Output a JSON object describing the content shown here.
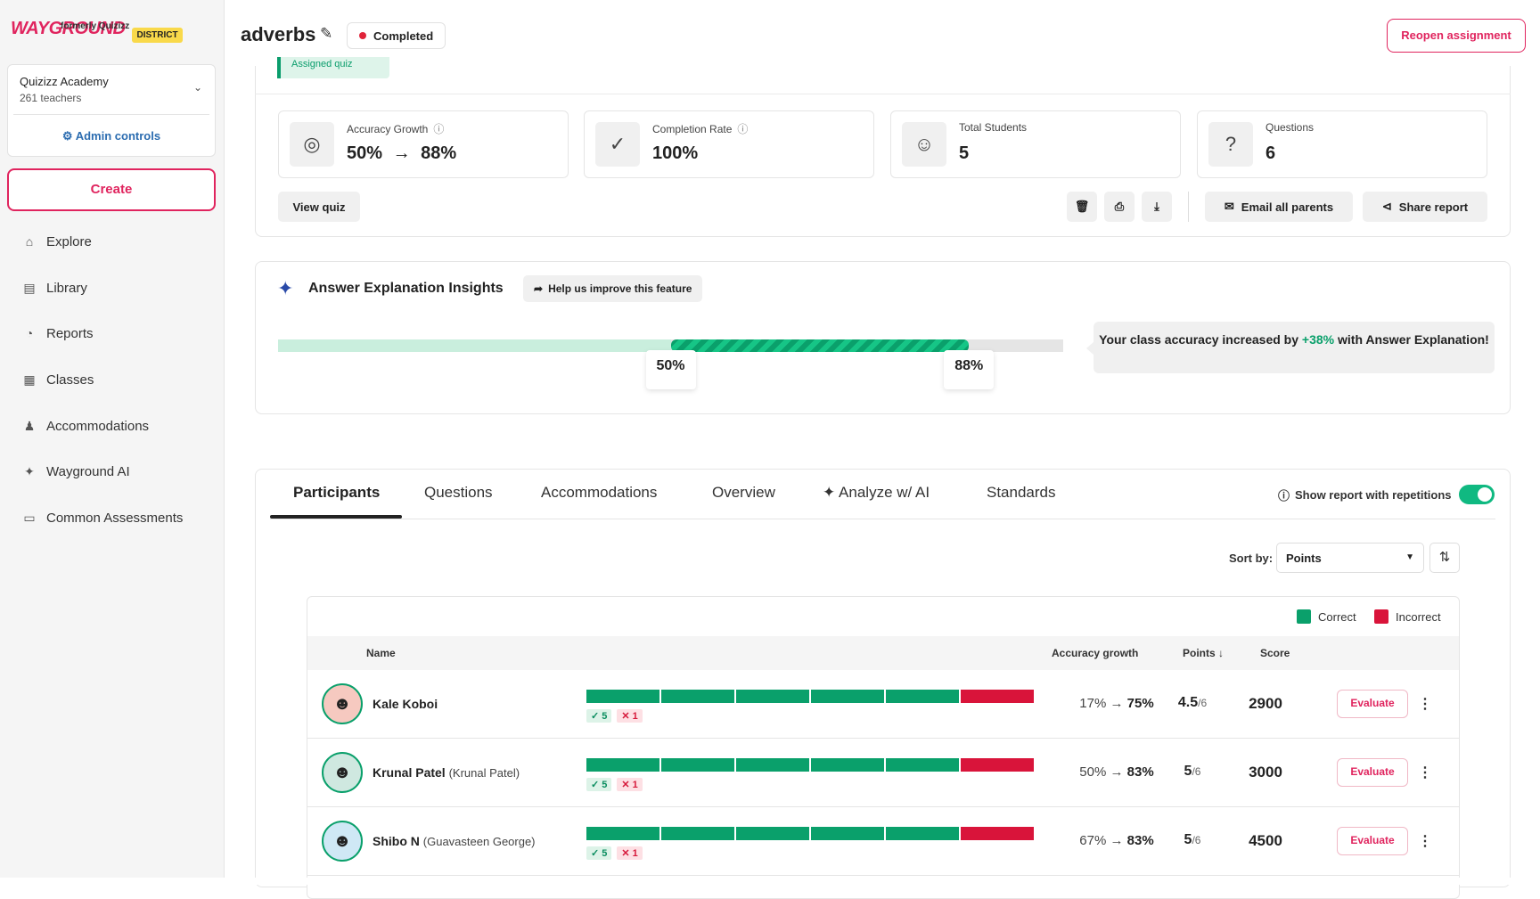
{
  "app": {
    "logo": "WAYGROUND",
    "logo_sub": "formerly Quizizz",
    "badge": "DISTRICT"
  },
  "org": {
    "name": "Quizizz Academy",
    "sub": "261 teachers",
    "admin": "Admin controls"
  },
  "sidebar": {
    "create": "Create",
    "items": [
      {
        "label": "Explore",
        "icon": "home-icon"
      },
      {
        "label": "Library",
        "icon": "library-icon"
      },
      {
        "label": "Reports",
        "icon": "reports-icon"
      },
      {
        "label": "Classes",
        "icon": "classes-icon"
      },
      {
        "label": "Accommodations",
        "icon": "accommodations-icon"
      },
      {
        "label": "Wayground AI",
        "icon": "sparkle-icon"
      },
      {
        "label": "Common Assessments",
        "icon": "clipboard-icon"
      }
    ]
  },
  "header": {
    "title": "adverbs",
    "status": "Completed",
    "reopen": "Reopen assignment",
    "assigned_tag": "Assigned quiz"
  },
  "stats": [
    {
      "label": "Accuracy Growth",
      "from": "50%",
      "to": "88%"
    },
    {
      "label": "Completion Rate",
      "value": "100%"
    },
    {
      "label": "Total Students",
      "value": "5"
    },
    {
      "label": "Questions",
      "value": "6"
    }
  ],
  "actions": {
    "view_quiz": "View quiz",
    "email": "Email all parents",
    "share": "Share report"
  },
  "insights": {
    "title": "Answer Explanation Insights",
    "help": "Help us improve this feature",
    "from_pct": 50,
    "to_pct": 88,
    "from_label": "50%",
    "to_label": "88%",
    "msg_pre": "Your class accuracy increased by",
    "msg_delta": "+38%",
    "msg_post": "with Answer Explanation!"
  },
  "tabs": [
    {
      "label": "Participants",
      "active": true
    },
    {
      "label": "Questions"
    },
    {
      "label": "Accommodations"
    },
    {
      "label": "Overview"
    },
    {
      "label": "Analyze w/ AI"
    },
    {
      "label": "Standards"
    }
  ],
  "report": {
    "repetitions_label": "Show report with repetitions",
    "repetitions_on": true,
    "sort_label": "Sort by:",
    "sort_value": "Points"
  },
  "legend": {
    "correct": "Correct",
    "incorrect": "Incorrect",
    "correct_color": "#0aa06b",
    "incorrect_color": "#d9143a"
  },
  "table": {
    "headers": {
      "name": "Name",
      "accuracy": "Accuracy growth",
      "points": "Points",
      "score": "Score"
    },
    "rows": [
      {
        "name": "Kale Koboi",
        "alt": "",
        "answers": [
          "c",
          "c",
          "c",
          "c",
          "c",
          "i"
        ],
        "correct": "5",
        "incorrect": "1",
        "acc_from": "17%",
        "acc_to": "75%",
        "points": "4.5",
        "points_max": "/6",
        "score": "2900",
        "action": "Evaluate",
        "avatar_icon": "monster-avatar-icon"
      },
      {
        "name": "Krunal Patel",
        "alt": "(Krunal Patel)",
        "answers": [
          "c",
          "c",
          "c",
          "c",
          "c",
          "i"
        ],
        "correct": "5",
        "incorrect": "1",
        "acc_from": "50%",
        "acc_to": "83%",
        "points": "5",
        "points_max": "/6",
        "score": "3000",
        "action": "Evaluate",
        "avatar_icon": "monster-avatar-icon"
      },
      {
        "name": "Shibo N",
        "alt": "(Guavasteen George)",
        "answers": [
          "c",
          "c",
          "c",
          "c",
          "c",
          "i"
        ],
        "correct": "5",
        "incorrect": "1",
        "acc_from": "67%",
        "acc_to": "83%",
        "points": "5",
        "points_max": "/6",
        "score": "4500",
        "action": "Evaluate",
        "avatar_icon": "monster-avatar-icon"
      }
    ]
  }
}
